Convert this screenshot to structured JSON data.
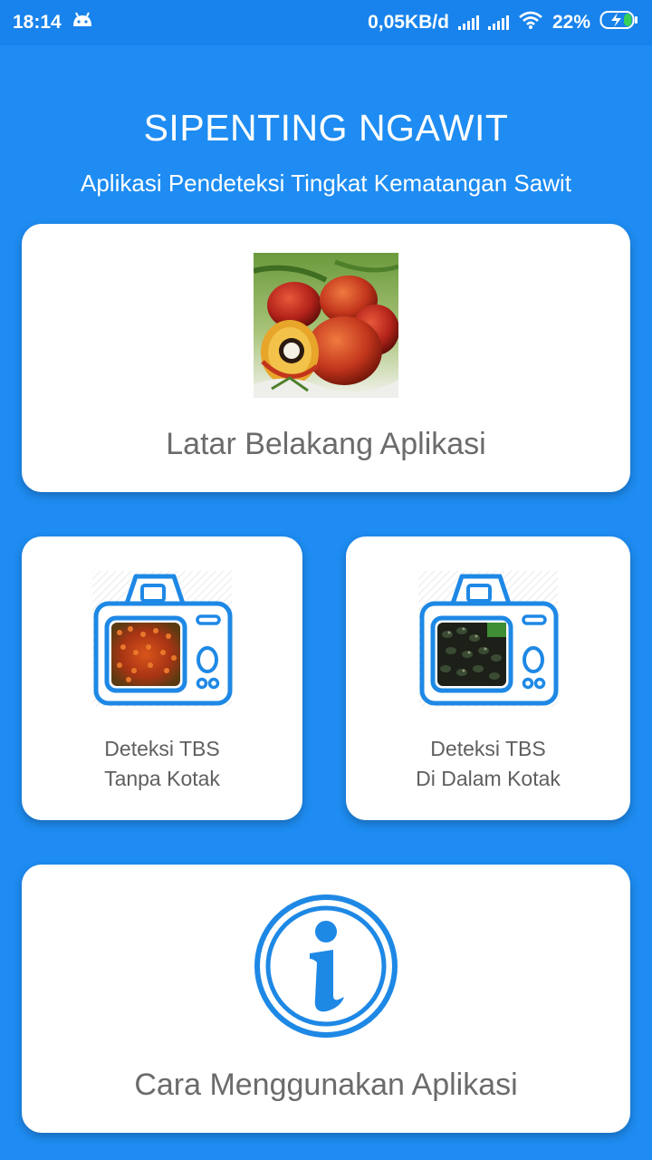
{
  "status_bar": {
    "time": "18:14",
    "network_speed": "0,05KB/d",
    "battery": "22%",
    "icons": [
      "android-icon",
      "signal-icon",
      "signal-icon",
      "wifi-icon",
      "battery-charging-icon"
    ]
  },
  "header": {
    "title": "SIPENTING NGAWIT",
    "subtitle": "Aplikasi Pendeteksi Tingkat Kematangan Sawit"
  },
  "menu": {
    "background": {
      "label": "Latar Belakang Aplikasi",
      "icon": "palm-fruit-image"
    },
    "detect_without_box": {
      "line1": "Deteksi TBS",
      "line2": "Tanpa Kotak",
      "icon": "camera-icon"
    },
    "detect_in_box": {
      "line1": "Deteksi TBS",
      "line2": "Di Dalam Kotak",
      "icon": "camera-icon"
    },
    "how_to_use": {
      "label": "Cara Menggunakan Aplikasi",
      "icon": "info-icon"
    }
  },
  "colors": {
    "background": "#1e8cf2",
    "status_bar": "#1883ec",
    "accent": "#1e88e5",
    "card": "#ffffff",
    "label_text": "#6b6b6b"
  }
}
